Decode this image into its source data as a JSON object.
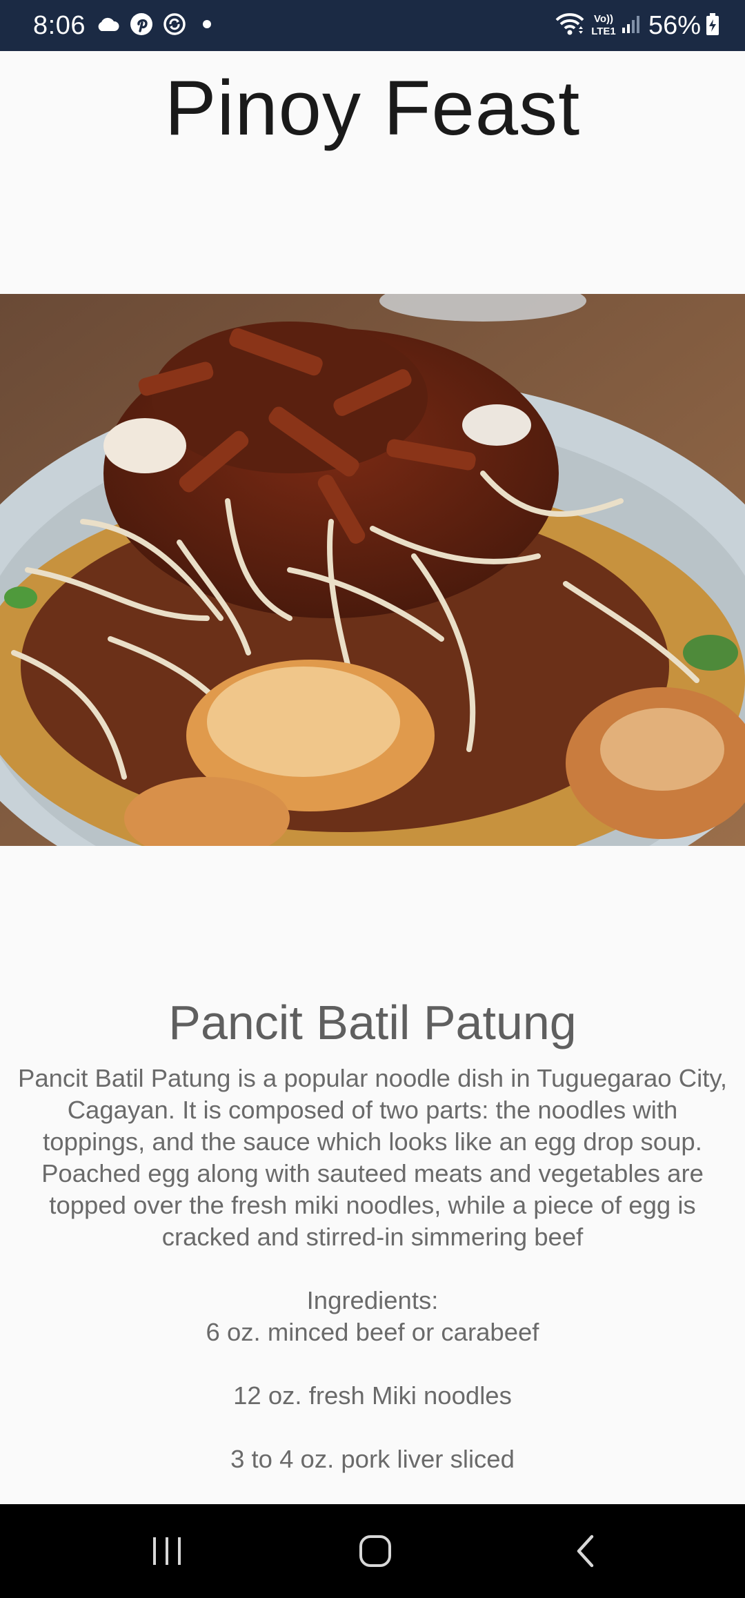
{
  "status_bar": {
    "time": "8:06",
    "left_icons": [
      "cloud-icon",
      "pinterest-icon",
      "sync-icon",
      "dot-icon"
    ],
    "right_icons": [
      "wifi-icon",
      "volte-lte1-icon",
      "signal-icon",
      "battery-charging-icon"
    ],
    "volte_label_top": "Vo))",
    "volte_label_bottom": "LTE1",
    "battery": "56%"
  },
  "app": {
    "title": "Pinoy Feast"
  },
  "recipe": {
    "image_subject": "pancit-batil-patung-photo",
    "title": "Pancit Batil Patung",
    "description": "Pancit Batil Patung is a popular noodle dish in Tuguegarao City, Cagayan. It is composed of two parts: the noodles with toppings, and the sauce which looks like an egg drop soup. Poached egg along with sauteed meats and vegetables are topped over the fresh miki noodles, while a piece of egg is cracked and stirred-in simmering beef",
    "ingredients_heading": "Ingredients:",
    "ingredients": [
      "6 oz. minced beef or carabeef",
      "12 oz. fresh Miki noodles",
      "3 to 4 oz. pork liver sliced"
    ]
  },
  "nav_bar": {
    "buttons": [
      "recent-apps-icon",
      "home-icon",
      "back-icon"
    ]
  },
  "colors": {
    "status_bar_bg": "#1b2a44",
    "background": "#fafafa",
    "nav_bar_bg": "#000000",
    "title_text": "#1a1a1a",
    "body_text": "#6a6a6a"
  }
}
